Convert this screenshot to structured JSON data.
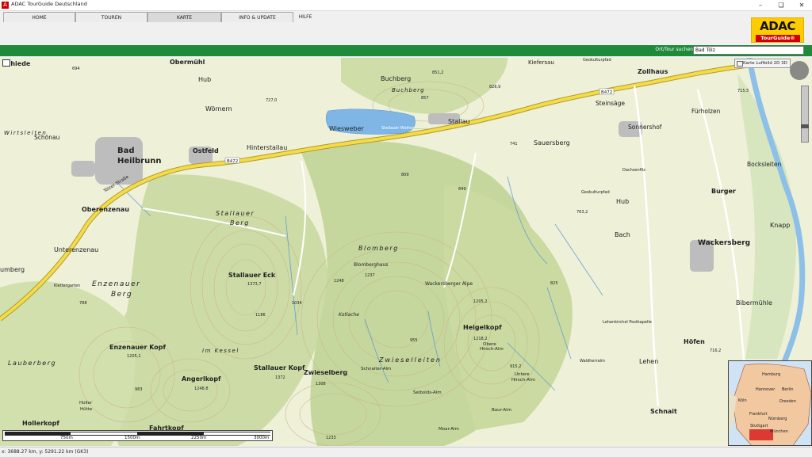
{
  "window": {
    "title": "ADAC TourGuide Deutschland",
    "app_icon": "A"
  },
  "tabs": [
    {
      "label": "HOME"
    },
    {
      "label": "TOUREN"
    },
    {
      "label": "KARTE"
    },
    {
      "label": "INFO & UPDATE"
    },
    {
      "label": "HILFE"
    }
  ],
  "logo": {
    "big": "ADAC",
    "small": "TourGuide®"
  },
  "search": {
    "label": "Ort/Tour suchen",
    "value": "Bad Tölz"
  },
  "layer_control": {
    "label": "Karte Luftbild 2D 3D"
  },
  "status": {
    "coords": "x: 3688.27 km, y: 5291.22 km (GK3)"
  },
  "scale": {
    "labels": [
      "750m",
      "1500m",
      "2250m",
      "3000m"
    ]
  },
  "colors": {
    "green_bar": "#1f8a3a",
    "road_yellow": "#f4dc48",
    "lake_blue": "#7fb6e6",
    "forest_green": "#c9d9a2"
  },
  "map_labels": [
    {
      "name": "mhiede",
      "text": "mhiede"
    },
    {
      "name": "obermuehl",
      "text": "Obermühl"
    },
    {
      "name": "hub-west",
      "text": "Hub"
    },
    {
      "name": "woernern",
      "text": "Wörnern"
    },
    {
      "name": "kiefersau",
      "text": "Kiefersau"
    },
    {
      "name": "geokulturpfad-top",
      "text": "Geokulturpfad"
    },
    {
      "name": "zollhaus",
      "text": "Zollhaus"
    },
    {
      "name": "buchberg",
      "text": "Buchberg"
    },
    {
      "name": "buchberg-ital",
      "text": "Buchberg"
    },
    {
      "name": "steinsage",
      "text": "Steinsäge"
    },
    {
      "name": "fuerholzen",
      "text": "Fürholzen"
    },
    {
      "name": "sonnershof",
      "text": "Sonnershof"
    },
    {
      "name": "schoenau",
      "text": "Schönau"
    },
    {
      "name": "wirtsleiten",
      "text": "Wirtsleiten"
    },
    {
      "name": "bad-heilbrunn-1",
      "text": "Bad"
    },
    {
      "name": "bad-heilbrunn-2",
      "text": "Heilbrunn"
    },
    {
      "name": "ostfeld",
      "text": "Ostfeld"
    },
    {
      "name": "hinterstallau",
      "text": "Hinterstallau"
    },
    {
      "name": "wiesweber",
      "text": "Wiesweber"
    },
    {
      "name": "stallauer-weiher",
      "text": "Stallauer Weiher"
    },
    {
      "name": "stallau",
      "text": "Stallau"
    },
    {
      "name": "sauersberg",
      "text": "Sauersberg"
    },
    {
      "name": "dachsenfilz",
      "text": "Dachsenfilz"
    },
    {
      "name": "bocksleiten",
      "text": "Bocksleiten"
    },
    {
      "name": "burger",
      "text": "Burger"
    },
    {
      "name": "geokulturpfad-mid",
      "text": "Geokulturpfad"
    },
    {
      "name": "hub-east",
      "text": "Hub"
    },
    {
      "name": "oberenzenau",
      "text": "Oberenzenau"
    },
    {
      "name": "stallauer-berg-1",
      "text": "Stallauer"
    },
    {
      "name": "stallauer-berg-2",
      "text": "Berg"
    },
    {
      "name": "knapp",
      "text": "Knapp"
    },
    {
      "name": "bach",
      "text": "Bach"
    },
    {
      "name": "wackersberg",
      "text": "Wackersberg"
    },
    {
      "name": "unterenzenau",
      "text": "Unterenzenau"
    },
    {
      "name": "blomberg-ital",
      "text": "Blomberg"
    },
    {
      "name": "blomberghaus",
      "text": "Blomberghaus"
    },
    {
      "name": "umberg",
      "text": "umberg"
    },
    {
      "name": "klettergarten",
      "text": "Klettergarten"
    },
    {
      "name": "stallauer-eck",
      "text": "Stallauer Eck"
    },
    {
      "name": "wackersberger-alpe",
      "text": "Wackersberger Alpe"
    },
    {
      "name": "enzenauer-berg-1",
      "text": "Enzenauer"
    },
    {
      "name": "enzenauer-berg-2",
      "text": "Berg"
    },
    {
      "name": "bibermuehle",
      "text": "Bibermühle"
    },
    {
      "name": "kotlache",
      "text": "Kotlache"
    },
    {
      "name": "heigelkopf",
      "text": "Heigelkopf"
    },
    {
      "name": "lehenkirchel",
      "text": "Lehenkirchel Postkapelle"
    },
    {
      "name": "enzenauer-kopf",
      "text": "Enzenauer Kopf"
    },
    {
      "name": "im-kessel",
      "text": "Im Kessel"
    },
    {
      "name": "obere-hirsch-alm-1",
      "text": "Obere"
    },
    {
      "name": "obere-hirsch-alm-2",
      "text": "Hirsch-Alm"
    },
    {
      "name": "hoefen",
      "text": "Höfen"
    },
    {
      "name": "lauberberg",
      "text": "Lauberberg"
    },
    {
      "name": "zwieselleiten",
      "text": "Zwieselleiten"
    },
    {
      "name": "waldherralm",
      "text": "Waldherralm"
    },
    {
      "name": "lehen",
      "text": "Lehen"
    },
    {
      "name": "stallauer-kopf",
      "text": "Stallauer Kopf"
    },
    {
      "name": "angerlkopf",
      "text": "Angerlkopf"
    },
    {
      "name": "zwieselberg",
      "text": "Zwieselberg"
    },
    {
      "name": "schnaiter-alm",
      "text": "Schnaiter-Alm"
    },
    {
      "name": "untere-hirsch-alm-1",
      "text": "Untere"
    },
    {
      "name": "untere-hirsch-alm-2",
      "text": "Hirsch-Alm"
    },
    {
      "name": "seibolds-alm",
      "text": "Seibolds-Alm"
    },
    {
      "name": "hollerkopf",
      "text": "Hollerkopf"
    },
    {
      "name": "fahrtkopf",
      "text": "Fahrtkopf"
    },
    {
      "name": "baur-alm",
      "text": "Baur-Alm"
    },
    {
      "name": "schnait",
      "text": "Schnait"
    },
    {
      "name": "moar-alm",
      "text": "Moar-Alm"
    },
    {
      "name": "holler-huette-1",
      "text": "Holler"
    },
    {
      "name": "holler-huette-2",
      "text": "Hütte"
    }
  ],
  "road_labels": [
    {
      "name": "b472-west",
      "text": "B472"
    },
    {
      "name": "b472-east",
      "text": "B472"
    },
    {
      "name": "toelzer-strasse",
      "text": "Tölzer Straße"
    }
  ],
  "peaks": [
    {
      "name": "peak-1373",
      "text": "1373,7"
    },
    {
      "name": "peak-1237",
      "text": "1237"
    },
    {
      "name": "peak-1248",
      "text": "1248"
    },
    {
      "name": "peak-1034",
      "text": "1034"
    },
    {
      "name": "peak-1186",
      "text": "1186"
    },
    {
      "name": "peak-1205-1",
      "text": "1205,1"
    },
    {
      "name": "peak-1205-2",
      "text": "1205,2"
    },
    {
      "name": "peak-1218",
      "text": "1218,2"
    },
    {
      "name": "peak-1372",
      "text": "1372"
    },
    {
      "name": "peak-1308",
      "text": "1308"
    },
    {
      "name": "peak-1248-8",
      "text": "1248,8"
    },
    {
      "name": "peak-983",
      "text": "983"
    },
    {
      "name": "peak-955",
      "text": "955"
    },
    {
      "name": "peak-915",
      "text": "915,2"
    },
    {
      "name": "peak-851",
      "text": "851,2"
    },
    {
      "name": "peak-826",
      "text": "826,9"
    },
    {
      "name": "peak-857",
      "text": "857"
    },
    {
      "name": "peak-727",
      "text": "727,0"
    },
    {
      "name": "peak-741",
      "text": "741"
    },
    {
      "name": "peak-809",
      "text": "809"
    },
    {
      "name": "peak-849",
      "text": "849"
    },
    {
      "name": "peak-763",
      "text": "763,2"
    },
    {
      "name": "peak-715",
      "text": "715,5"
    },
    {
      "name": "peak-716",
      "text": "716,2"
    },
    {
      "name": "peak-825",
      "text": "825"
    },
    {
      "name": "peak-1233",
      "text": "1233"
    },
    {
      "name": "peak-788",
      "text": "788"
    },
    {
      "name": "peak-694",
      "text": "694"
    }
  ],
  "minimap": {
    "cities": [
      {
        "name": "hamburg",
        "text": "Hamburg"
      },
      {
        "name": "hannover",
        "text": "Hannover"
      },
      {
        "name": "berlin",
        "text": "Berlin"
      },
      {
        "name": "koeln",
        "text": "Köln"
      },
      {
        "name": "dresden",
        "text": "Dresden"
      },
      {
        "name": "frankfurt",
        "text": "Frankfurt"
      },
      {
        "name": "nuernberg",
        "text": "Nürnberg"
      },
      {
        "name": "stuttgart",
        "text": "Stuttgart"
      },
      {
        "name": "muenchen",
        "text": "München"
      }
    ]
  }
}
